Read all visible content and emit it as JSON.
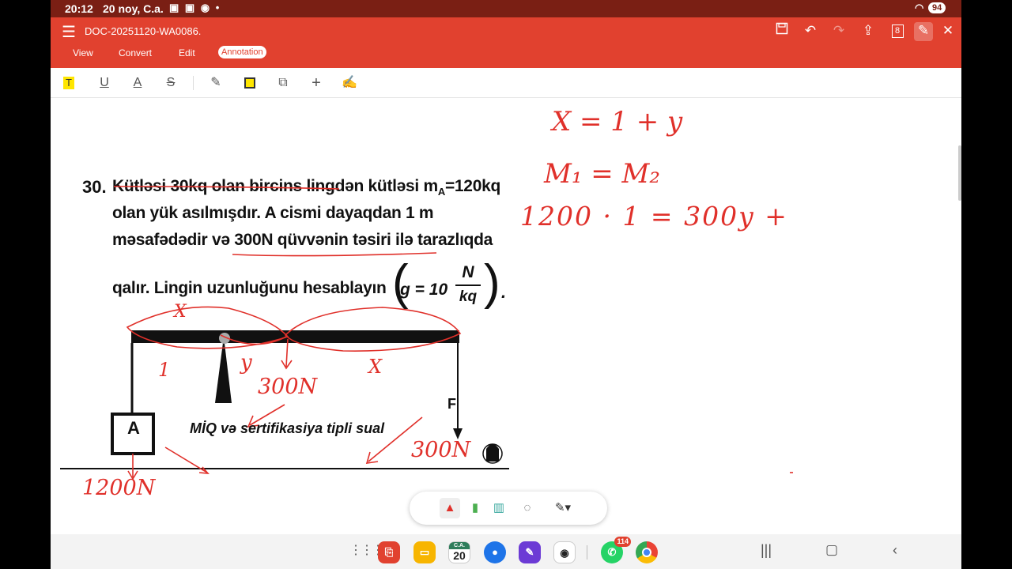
{
  "status_bar": {
    "time": "20:12",
    "date": "20 noy, C.a.",
    "battery": "94"
  },
  "app_bar": {
    "doc_title": "DOC-20251120-WA0086.",
    "tabs": [
      "View",
      "Convert",
      "Edit",
      "Annotation"
    ],
    "active_tab": "Annotation",
    "page_count_badge": "8",
    "icons": [
      "save-icon",
      "undo-icon",
      "redo-icon",
      "share-icon",
      "pages-icon",
      "pen-edit-icon",
      "close-icon"
    ]
  },
  "annotation_tools": [
    "highlight-text-icon",
    "underline-icon",
    "strikeout-icon",
    "squiggly-icon",
    "pen-icon",
    "rectangle-icon",
    "shapes-icon",
    "add-icon",
    "signature-icon"
  ],
  "document": {
    "question_number": "30.",
    "lines": [
      "Kütləsi 30kq olan bircins lingdən kütləsi m",
      "olan yük asılmışdır. A cismi dayaqdan 1 m",
      "məsafədədir və 300N qüvvənin təsiri ilə tarazlıqda",
      "qalır. Lingin uzunluğunu hesablayın"
    ],
    "mass_value": "=120kq",
    "mass_subscript": "A",
    "formula_g": "g = 10",
    "formula_num": "N",
    "formula_den": "kq",
    "figure": {
      "block_label": "A",
      "force_label": "F",
      "caption": "MİQ və sertifikasiya tipli sual"
    }
  },
  "handwriting": [
    "X = 1 + y",
    "M₁ = M₂",
    "1200 · 1 = 300y +",
    "X",
    "1",
    "y",
    "300N",
    "X",
    "300N",
    "1200N"
  ],
  "colors": {
    "accent": "#e1412f",
    "status_bar": "#7a1f14",
    "ink": "#e0302a"
  },
  "taskbar": {
    "calendar_day": "20",
    "calendar_label": "C.A.",
    "whatsapp_badge": "114"
  }
}
